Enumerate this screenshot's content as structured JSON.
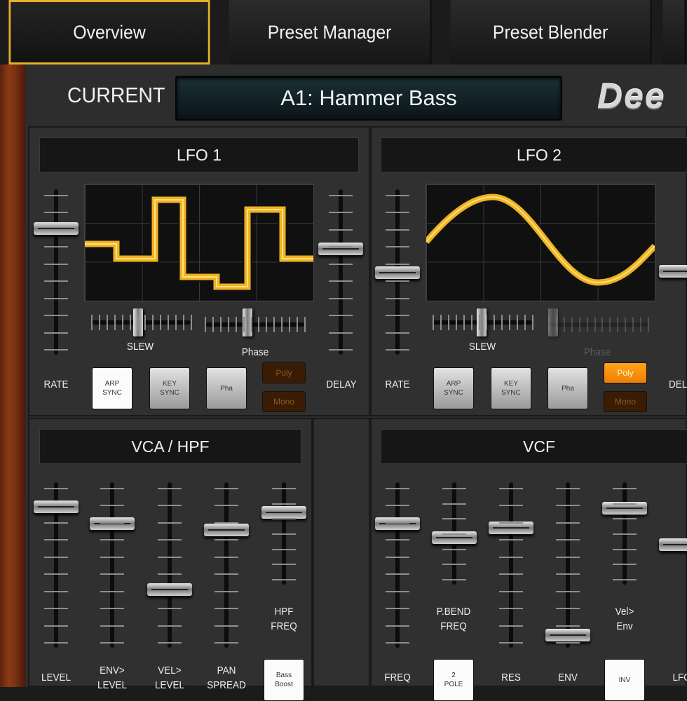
{
  "tabs": [
    {
      "label": "Overview",
      "active": true
    },
    {
      "label": "Preset Manager",
      "active": false
    },
    {
      "label": "Preset Blender",
      "active": false
    }
  ],
  "header": {
    "current_label": "CURRENT",
    "preset_name": "A1: Hammer Bass",
    "logo_text": "Dee"
  },
  "lfo1": {
    "title": "LFO 1",
    "rate_label": "RATE",
    "delay_label": "DELAY",
    "slew_label": "SLEW",
    "phase_label": "Phase",
    "arp_sync": "ARP\nSYNC",
    "key_sync": "KEY\nSYNC",
    "pha": "Pha",
    "poly": "Poly",
    "mono": "Mono",
    "arp_sync_on": true,
    "poly_on": false
  },
  "lfo2": {
    "title": "LFO 2",
    "rate_label": "RATE",
    "delay_label": "DELA",
    "slew_label": "SLEW",
    "phase_label": "Phase",
    "arp_sync": "ARP\nSYNC",
    "key_sync": "KEY\nSYNC",
    "pha": "Pha",
    "poly": "Poly",
    "mono": "Mono",
    "arp_sync_on": false,
    "poly_on": true
  },
  "vca": {
    "title": "VCA / HPF",
    "level": "LEVEL",
    "env_level": "ENV>\nLEVEL",
    "vel_level": "VEL>\nLEVEL",
    "pan_spread": "PAN\nSPREAD",
    "hpf_freq": "HPF\nFREQ",
    "bass_boost": "Bass\nBoost"
  },
  "vcf": {
    "title": "VCF",
    "freq": "FREQ",
    "pbend_freq": "P.BEND\nFREQ",
    "res": "RES",
    "env": "ENV",
    "vel_env": "Vel>\nEnv",
    "lfo": "LFO",
    "two_pole": "2\nPOLE",
    "inv": "INV"
  },
  "colors": {
    "accent": "#e6b12a",
    "wave": "#f0b224",
    "orange": "#ff9a14"
  }
}
